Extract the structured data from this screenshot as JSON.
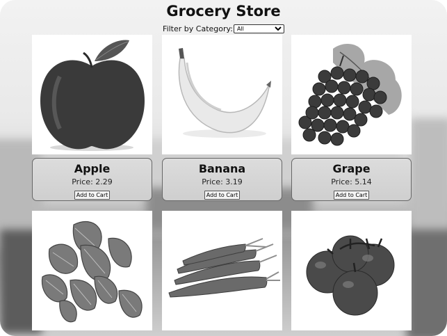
{
  "header": {
    "title": "Grocery Store"
  },
  "filter": {
    "label": "Filter by Category:",
    "selected": "All"
  },
  "products": [
    {
      "name": "Apple",
      "price_label": "Price: 2.29",
      "button": "Add to Cart",
      "icon": "apple-image"
    },
    {
      "name": "Banana",
      "price_label": "Price: 3.19",
      "button": "Add to Cart",
      "icon": "banana-image"
    },
    {
      "name": "Grape",
      "price_label": "Price: 5.14",
      "button": "Add to Cart",
      "icon": "grape-image"
    },
    {
      "name": "",
      "price_label": "",
      "button": "",
      "icon": "spinach-image"
    },
    {
      "name": "",
      "price_label": "",
      "button": "",
      "icon": "carrot-image"
    },
    {
      "name": "",
      "price_label": "",
      "button": "",
      "icon": "tomato-image"
    }
  ]
}
